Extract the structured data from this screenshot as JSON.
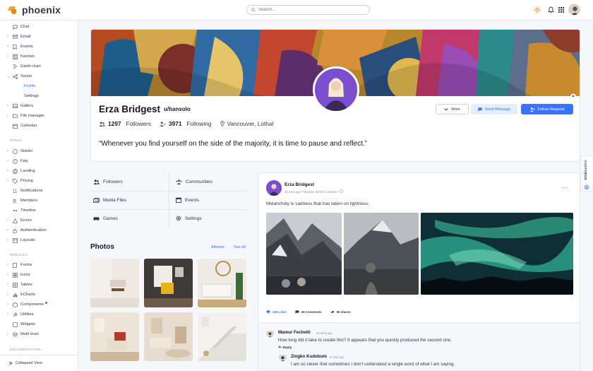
{
  "brand": {
    "name": "phoenix"
  },
  "search": {
    "placeholder": "Search..."
  },
  "sidebar": {
    "items": [
      {
        "label": "Chat",
        "icon": "chat-icon"
      },
      {
        "label": "Email",
        "icon": "mail-icon"
      },
      {
        "label": "Events",
        "icon": "bookmark-icon"
      },
      {
        "label": "Kanban",
        "icon": "kanban-icon"
      },
      {
        "label": "Gantt chart",
        "icon": "gantt-icon"
      },
      {
        "label": "Social",
        "icon": "share-icon"
      },
      {
        "label": "Profile",
        "icon": ""
      },
      {
        "label": "Settings",
        "icon": ""
      },
      {
        "label": "Gallery",
        "icon": "image-icon"
      },
      {
        "label": "File manager",
        "icon": "folder-icon"
      },
      {
        "label": "Calendar",
        "icon": "calendar-icon"
      }
    ],
    "pages_title": "PAGES",
    "pages": [
      {
        "label": "Starter"
      },
      {
        "label": "Faq"
      },
      {
        "label": "Landing"
      },
      {
        "label": "Pricing"
      },
      {
        "label": "Notifications"
      },
      {
        "label": "Members"
      },
      {
        "label": "Timeline"
      },
      {
        "label": "Errors"
      },
      {
        "label": "Authentication"
      },
      {
        "label": "Layouts"
      }
    ],
    "modules_title": "MODULES",
    "modules": [
      {
        "label": "Forms"
      },
      {
        "label": "Icons"
      },
      {
        "label": "Tables"
      },
      {
        "label": "ECharts"
      },
      {
        "label": "Components"
      },
      {
        "label": "Utilities"
      },
      {
        "label": "Widgets"
      },
      {
        "label": "Multi level"
      }
    ],
    "documentation_title": "DOCUMENTATION",
    "collapse_label": "Collapsed View"
  },
  "profile": {
    "name": "Erza Bridgest",
    "handle": "u/hansolo",
    "followers_count": "1297",
    "followers_label": "Followers",
    "following_count": "3971",
    "following_label": "Following",
    "location": "Vancouver, Lothal",
    "quote": "“Whenever you find yourself on the side of the majority, it is time to pause and reflect.”",
    "more_label": "More",
    "send_label": "Send Message",
    "follow_label": "Follow Request"
  },
  "tabs": [
    {
      "label": "Followers"
    },
    {
      "label": "Communities"
    },
    {
      "label": "Media Files"
    },
    {
      "label": "Events"
    },
    {
      "label": "Games"
    },
    {
      "label": "Settings"
    }
  ],
  "photos": {
    "title": "Photos",
    "albums_label": "Albums",
    "see_all_label": "See all"
  },
  "post": {
    "author": "Erza Bridgest",
    "meta": "35 mins ago • Medulla, British Columbia •",
    "text": "Melancholy is sadness that has taken on lightness.",
    "likes": "345 Likes",
    "comments": "45 Comments",
    "shares": "58 shares"
  },
  "comments": [
    {
      "name": "Mamur Fechetti",
      "time": "35 mins ago",
      "text": "How long did it take to create this? It appears that you quickly produced the second one.",
      "reply": "Reply"
    },
    {
      "name": "Zingko Kudobum",
      "time": "5 mins ago",
      "text": "I am so clever that sometimes I don't understand a single word of what I am saying."
    }
  ],
  "customize": {
    "label": "CUSTOMIZE"
  },
  "colors": {
    "primary": "#3874ff",
    "primary_soft": "#e5edff",
    "text": "#141824",
    "muted": "#8a94ad",
    "border": "#e3e6ed"
  }
}
